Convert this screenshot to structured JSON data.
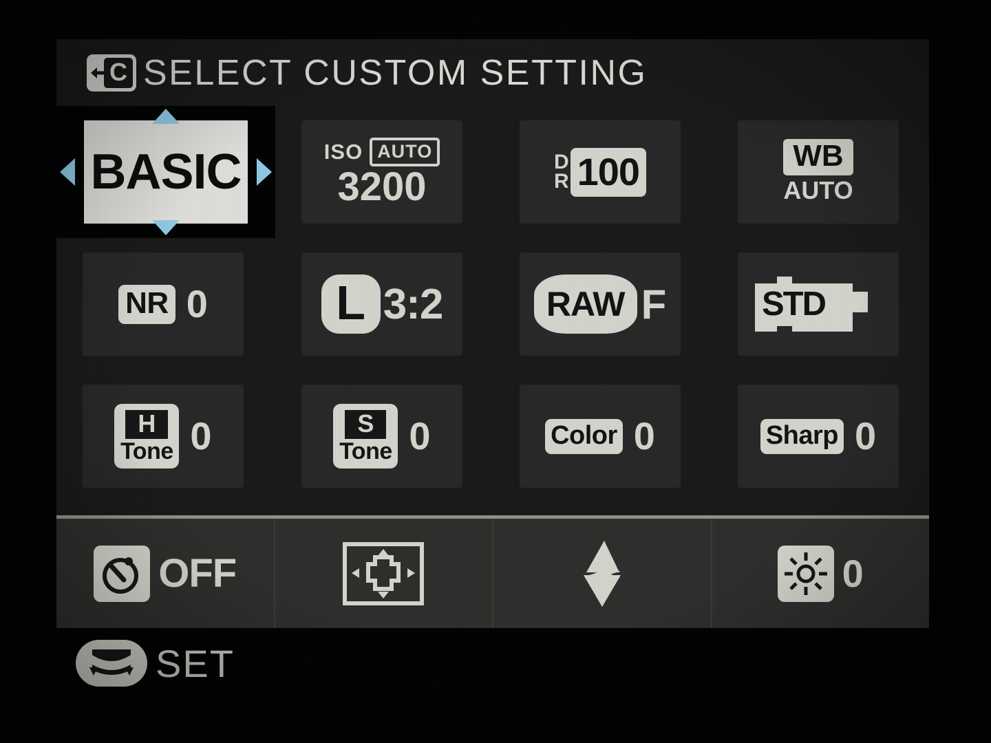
{
  "header": {
    "icon": "back-c-icon",
    "title": "SELECT CUSTOM SETTING"
  },
  "selection": {
    "label": "BASIC",
    "arrow_color": "#8ec9e4",
    "highlight_bg": "#dededa",
    "highlight_fg": "#0a0a0a"
  },
  "colors": {
    "lcd_text": "#d5d5cd",
    "panel_bg": "#181818",
    "tile_bg": "#262626",
    "toolbar_bg": "#2c2c2a",
    "toolbar_border": "#8f8f88"
  },
  "grid": {
    "row1": [
      {
        "id": "custom-bank",
        "kind": "selected",
        "label": "BASIC"
      },
      {
        "id": "iso",
        "kind": "iso",
        "prefix": "ISO",
        "mode": "AUTO",
        "value": "3200"
      },
      {
        "id": "dynamic-range",
        "kind": "dr",
        "line1": "D",
        "line2": "R",
        "value": "100"
      },
      {
        "id": "white-balance",
        "kind": "wb",
        "label": "WB",
        "value": "AUTO"
      }
    ],
    "row2": [
      {
        "id": "noise-reduction",
        "kind": "boxed-value",
        "label": "NR",
        "value": "0"
      },
      {
        "id": "image-size",
        "kind": "size",
        "label": "L",
        "value": "3:2"
      },
      {
        "id": "image-quality",
        "kind": "raw",
        "label": "RAW",
        "value": "F"
      },
      {
        "id": "film-simulation",
        "kind": "film",
        "label": "STD",
        "value": ""
      }
    ],
    "row3": [
      {
        "id": "highlight-tone",
        "kind": "tone",
        "letter": "H",
        "word": "Tone",
        "value": "0"
      },
      {
        "id": "shadow-tone",
        "kind": "tone",
        "letter": "S",
        "word": "Tone",
        "value": "0"
      },
      {
        "id": "color",
        "kind": "boxed-value",
        "label": "Color",
        "value": "0"
      },
      {
        "id": "sharpness",
        "kind": "boxed-value",
        "label": "Sharp",
        "value": "0"
      }
    ]
  },
  "toolbar": [
    {
      "id": "self-timer",
      "icon": "self-timer-icon",
      "value": "OFF"
    },
    {
      "id": "af-mode",
      "icon": "af-area-icon",
      "value": ""
    },
    {
      "id": "flash-mode",
      "icon": "flash-icon",
      "value": ""
    },
    {
      "id": "exposure-compensation",
      "icon": "brightness-sun-icon",
      "value": "0"
    }
  ],
  "footer": {
    "icon": "command-dial-icon",
    "label": "SET"
  }
}
